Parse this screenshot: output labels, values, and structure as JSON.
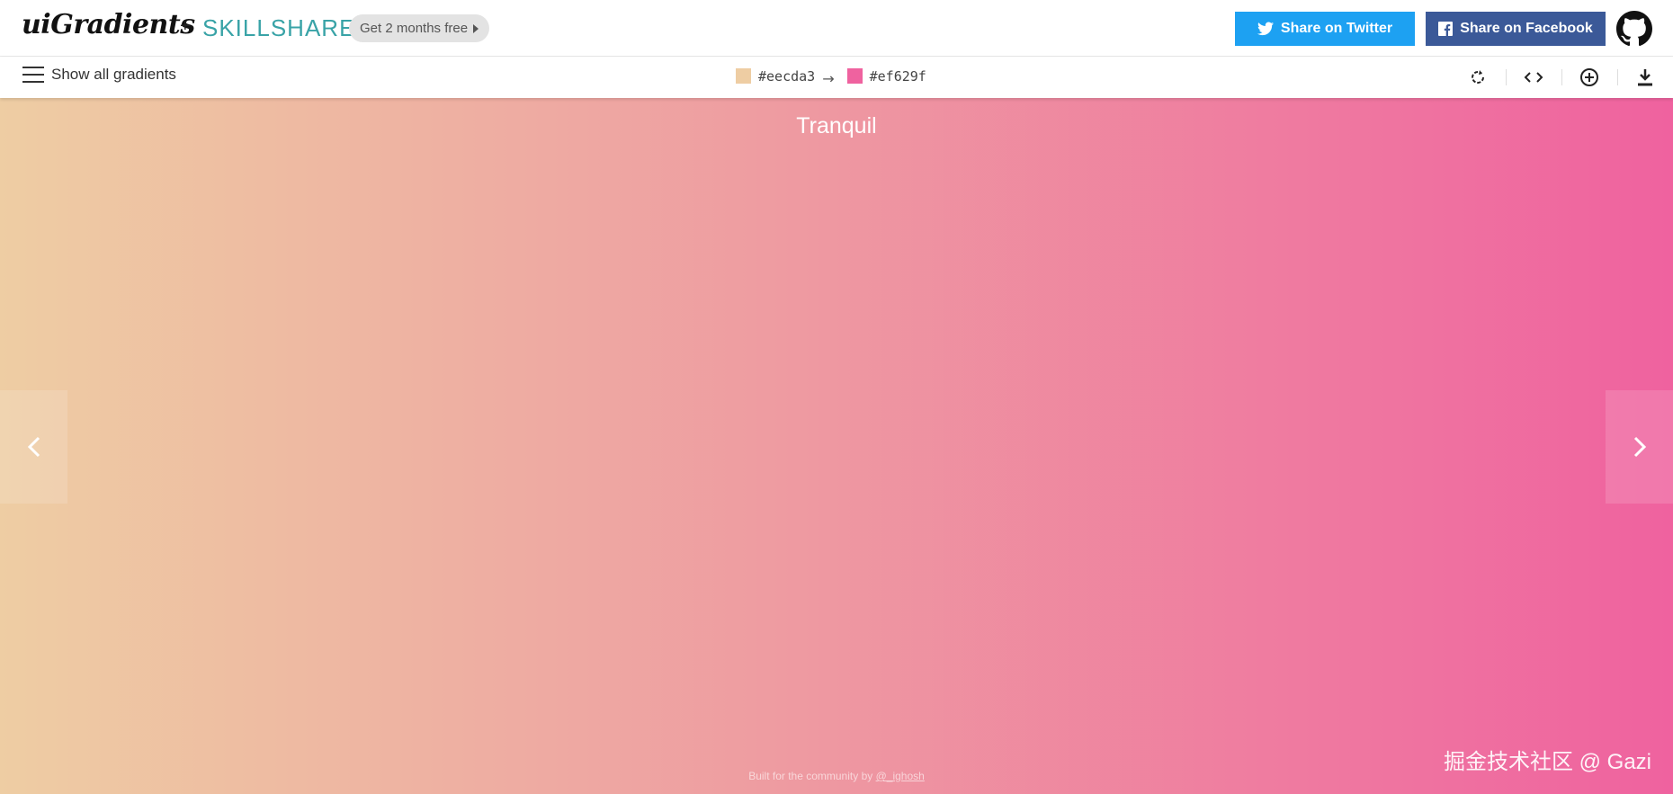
{
  "header": {
    "logo": "uiGradients",
    "plus": "+",
    "partner": "SKILLSHARE",
    "promo_label": "Get 2 months free",
    "twitter_label": "Share on Twitter",
    "facebook_label": "Share on Facebook",
    "icons": {
      "twitter": "twitter-bird-icon",
      "facebook": "facebook-icon",
      "github": "github-icon"
    }
  },
  "toolbar": {
    "show_all_label": "Show all gradients",
    "color_from": "#eecda3",
    "color_to": "#ef629f",
    "arrow": "→",
    "tools": [
      "rotate-icon",
      "code-icon",
      "add-icon",
      "download-icon"
    ]
  },
  "gradient": {
    "name": "Tranquil",
    "color_start": "#eecda3",
    "color_end": "#ef629f"
  },
  "footer": {
    "text": "Built for the community by",
    "author": "@_ighosh"
  },
  "watermark": "掘金技术社区 @ Gazi",
  "colors": {
    "twitter": "#1da1f2",
    "facebook": "#3b5998",
    "skillshare": "#39a3a7"
  }
}
